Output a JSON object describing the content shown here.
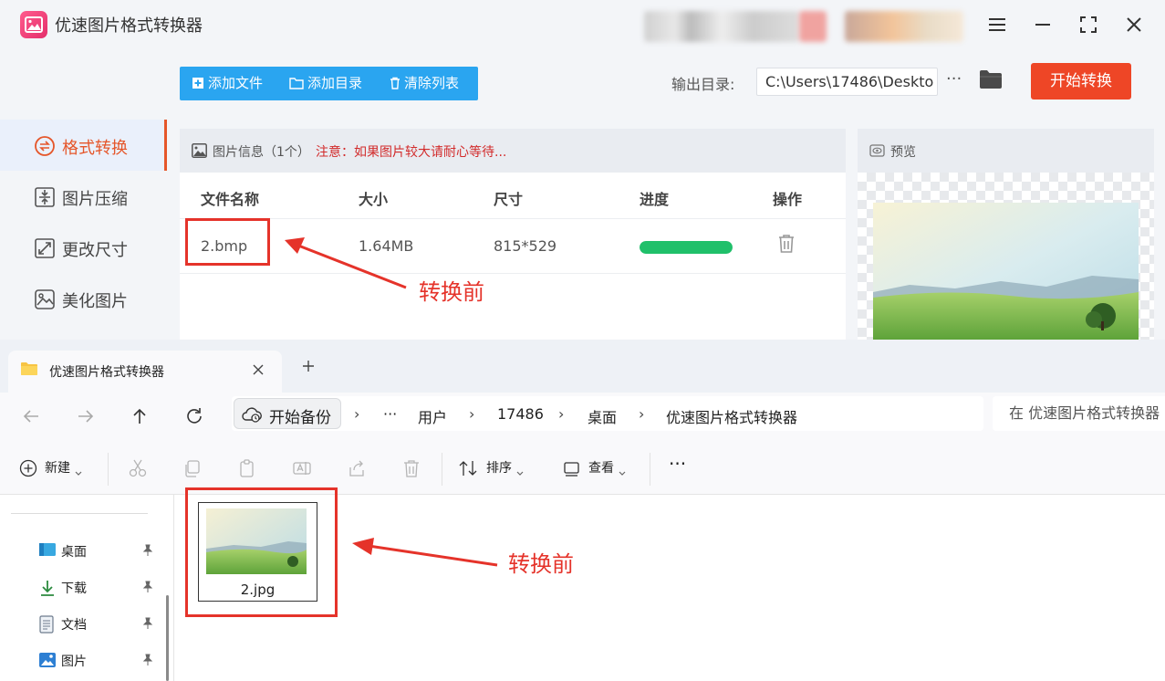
{
  "app": {
    "title": "优速图片格式转换器",
    "sidebar": [
      {
        "label": "格式转换",
        "icon": "convert-icon",
        "active": true
      },
      {
        "label": "图片压缩",
        "icon": "compress-icon",
        "active": false
      },
      {
        "label": "更改尺寸",
        "icon": "resize-icon",
        "active": false
      },
      {
        "label": "美化图片",
        "icon": "beautify-icon",
        "active": false
      }
    ],
    "toolbar": {
      "add_file": "添加文件",
      "add_dir": "添加目录",
      "clear_list": "清除列表"
    },
    "output": {
      "label": "输出目录:",
      "path": "C:\\Users\\17486\\Deskto",
      "more": "···"
    },
    "start_button": "开始转换",
    "file_panel": {
      "title": "图片信息（1个）",
      "note": "注意：如果图片较大请耐心等待...",
      "columns": [
        "文件名称",
        "大小",
        "尺寸",
        "进度",
        "操作"
      ],
      "rows": [
        {
          "name": "2.bmp",
          "size": "1.64MB",
          "dims": "815*529",
          "progress": 1.0
        }
      ]
    },
    "preview": {
      "title": "预览"
    }
  },
  "annotations": {
    "top_label": "转换前",
    "bottom_label": "转换前",
    "color": "#e5332a"
  },
  "explorer": {
    "tab_title": "优速图片格式转换器",
    "backup_label": "开始备份",
    "breadcrumb": [
      "···",
      "用户",
      "17486",
      "桌面",
      "优速图片格式转换器"
    ],
    "search_placeholder": "在 优速图片格式转换器",
    "commands": {
      "new": "新建",
      "sort": "排序",
      "view": "查看",
      "more": "···"
    },
    "nav_items": [
      {
        "label": "桌面",
        "icon": "desktop-icon"
      },
      {
        "label": "下载",
        "icon": "download-icon"
      },
      {
        "label": "文档",
        "icon": "document-icon"
      },
      {
        "label": "图片",
        "icon": "pictures-icon"
      }
    ],
    "file": {
      "name": "2.jpg"
    }
  },
  "colors": {
    "accent_orange": "#ee4626",
    "toolbar_blue": "#2aa5f0",
    "progress_green": "#20c06a",
    "annotation_red": "#e5332a"
  }
}
